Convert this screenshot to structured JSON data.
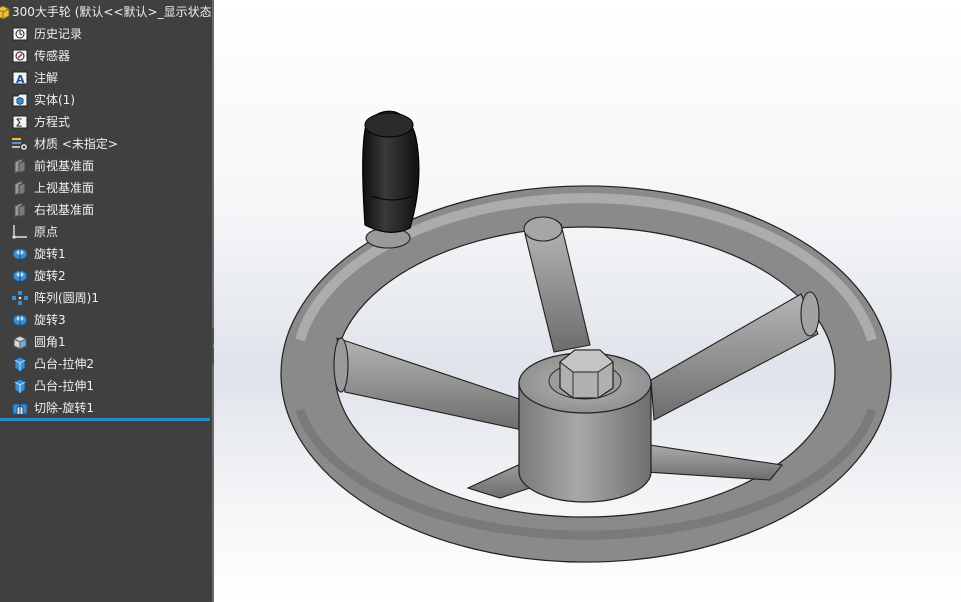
{
  "feature_tree": {
    "root_label": "300大手轮 (默认<<默认>_显示状态",
    "items": [
      {
        "label": "历史记录",
        "icon": "history-icon"
      },
      {
        "label": "传感器",
        "icon": "sensor-icon"
      },
      {
        "label": "注解",
        "icon": "annotation-icon"
      },
      {
        "label": "实体(1)",
        "icon": "solid-bodies-icon"
      },
      {
        "label": "方程式",
        "icon": "equations-icon"
      },
      {
        "label": "材质 <未指定>",
        "icon": "material-icon"
      },
      {
        "label": "前视基准面",
        "icon": "plane-icon"
      },
      {
        "label": "上视基准面",
        "icon": "plane-icon"
      },
      {
        "label": "右视基准面",
        "icon": "plane-icon"
      },
      {
        "label": "原点",
        "icon": "origin-icon"
      },
      {
        "label": "旋转1",
        "icon": "revolve-icon"
      },
      {
        "label": "旋转2",
        "icon": "revolve-icon"
      },
      {
        "label": "阵列(圆周)1",
        "icon": "circular-pattern-icon"
      },
      {
        "label": "旋转3",
        "icon": "revolve-icon"
      },
      {
        "label": "圆角1",
        "icon": "fillet-icon"
      },
      {
        "label": "凸台-拉伸2",
        "icon": "extrude-boss-icon"
      },
      {
        "label": "凸台-拉伸1",
        "icon": "extrude-boss-icon"
      },
      {
        "label": "切除-旋转1",
        "icon": "revolve-cut-icon"
      }
    ]
  },
  "colors": {
    "panel_background": "#404040",
    "panel_text": "#f0f0f0",
    "rollback_bar": "#2a8ac6",
    "icon_blue": "#3a8fd0",
    "part_gray": "#8c8c8c",
    "handle_black": "#1c1c1c"
  }
}
